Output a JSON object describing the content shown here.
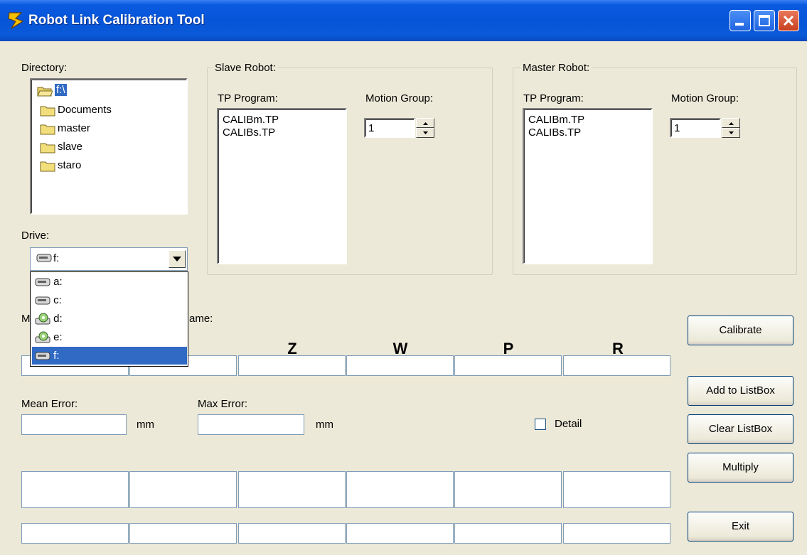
{
  "window": {
    "title": "Robot Link Calibration Tool"
  },
  "directory": {
    "label": "Directory:",
    "items": [
      "f:\\",
      "Documents",
      "master",
      "slave",
      "staro"
    ]
  },
  "drive": {
    "label": "Drive:",
    "selected": "f:",
    "options": [
      {
        "label": "a:",
        "icon": "drive-icon"
      },
      {
        "label": "c:",
        "icon": "drive-icon"
      },
      {
        "label": "d:",
        "icon": "cd-drive-icon"
      },
      {
        "label": "e:",
        "icon": "cd-drive-icon"
      },
      {
        "label": "f:",
        "icon": "drive-icon"
      }
    ]
  },
  "slave": {
    "group_title": "Slave Robot:",
    "tp_label": "TP Program:",
    "programs": [
      "CALIBm.TP",
      "CALIBs.TP"
    ],
    "motion_label": "Motion Group:",
    "motion_value": "1"
  },
  "master": {
    "group_title": "Master Robot:",
    "tp_label": "TP Program:",
    "programs": [
      "CALIBm.TP",
      "CALIBs.TP"
    ],
    "motion_label": "Motion Group:",
    "motion_value": "1"
  },
  "frame": {
    "label_left": "M",
    "label_right": "ame:",
    "headers": [
      "Z",
      "W",
      "P",
      "R"
    ]
  },
  "errors": {
    "mean_label": "Mean Error:",
    "max_label": "Max Error:",
    "unit": "mm",
    "detail_label": "Detail"
  },
  "buttons": {
    "calibrate": "Calibrate",
    "add": "Add to ListBox",
    "clear": "Clear ListBox",
    "multiply": "Multiply",
    "exit": "Exit"
  },
  "colors": {
    "selection": "#316ac5",
    "titlebar": "#0654d8",
    "window_bg": "#ece9d8"
  }
}
